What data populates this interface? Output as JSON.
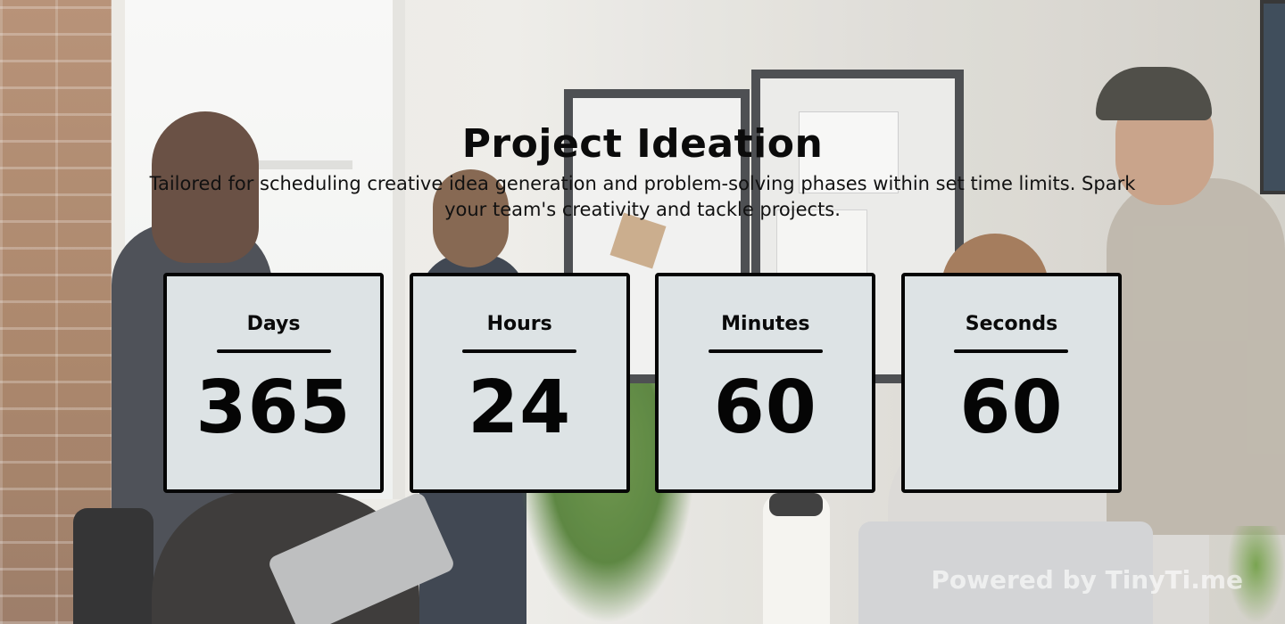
{
  "header": {
    "title": "Project Ideation",
    "description": "Tailored for scheduling creative idea generation and problem-solving phases within set time limits. Spark your team's creativity and tackle projects."
  },
  "timers": [
    {
      "label": "Days",
      "value": "365"
    },
    {
      "label": "Hours",
      "value": "24"
    },
    {
      "label": "Minutes",
      "value": "60"
    },
    {
      "label": "Seconds",
      "value": "60"
    }
  ],
  "footer": {
    "powered_by": "Powered by TinyTi.me"
  },
  "colors": {
    "card_background": "#dde3e5",
    "card_border": "#050505",
    "text": "#0b0b0b",
    "powered_text": "#ffffff"
  }
}
